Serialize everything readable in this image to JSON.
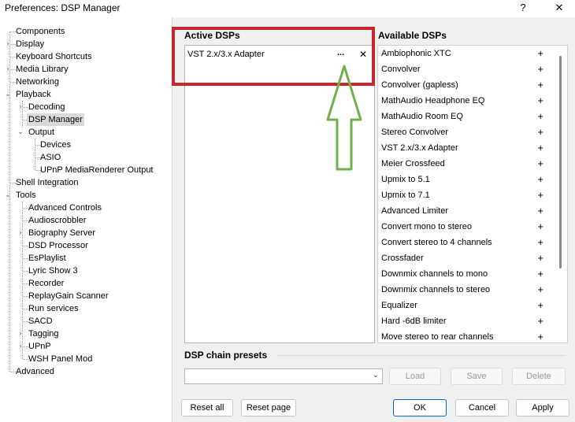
{
  "window": {
    "title": "Preferences: DSP Manager",
    "help_label": "?",
    "close_label": "✕"
  },
  "tree": {
    "components": "Components",
    "display": "Display",
    "keyboard_shortcuts": "Keyboard Shortcuts",
    "media_library": "Media Library",
    "networking": "Networking",
    "playback": "Playback",
    "decoding": "Decoding",
    "dsp_manager": "DSP Manager",
    "output": "Output",
    "devices": "Devices",
    "asio": "ASIO",
    "upnp_mediarenderer_output": "UPnP MediaRenderer Output",
    "shell_integration": "Shell Integration",
    "tools": "Tools",
    "advanced_controls": "Advanced Controls",
    "audioscrobbler": "Audioscrobbler",
    "biography_server": "Biography Server",
    "dsd_processor": "DSD Processor",
    "esplaylist": "EsPlaylist",
    "lyric_show_3": "Lyric Show 3",
    "recorder": "Recorder",
    "replaygain_scanner": "ReplayGain Scanner",
    "run_services": "Run services",
    "sacd": "SACD",
    "tagging": "Tagging",
    "upnp": "UPnP",
    "wsh_panel_mod": "WSH Panel Mod",
    "advanced": "Advanced"
  },
  "active_dsps": {
    "title": "Active DSPs",
    "items": [
      {
        "label": "VST 2.x/3.x Adapter",
        "configure_label": "...",
        "remove_label": "✕"
      }
    ]
  },
  "available_dsps": {
    "title": "Available DSPs",
    "add_label": "+",
    "items": [
      "Ambiophonic XTC",
      "Convolver",
      "Convolver (gapless)",
      "MathAudio Headphone EQ",
      "MathAudio Room EQ",
      "Stereo Convolver",
      "VST 2.x/3.x Adapter",
      "Meier Crossfeed",
      "Upmix to 5.1",
      "Upmix to 7.1",
      "Advanced Limiter",
      "Convert mono to stereo",
      "Convert stereo to 4 channels",
      "Crossfader",
      "Downmix channels to mono",
      "Downmix channels to stereo",
      "Equalizer",
      "Hard -6dB limiter",
      "Move stereo to rear channels"
    ]
  },
  "presets": {
    "title": "DSP chain presets",
    "combo_value": "",
    "load_label": "Load",
    "save_label": "Save",
    "delete_label": "Delete"
  },
  "footer": {
    "reset_all_label": "Reset all",
    "reset_page_label": "Reset page",
    "ok_label": "OK",
    "cancel_label": "Cancel",
    "apply_label": "Apply"
  },
  "colors": {
    "highlight_box": "#c8262f",
    "arrow": "#6fb04a",
    "accent": "#0067c0"
  }
}
